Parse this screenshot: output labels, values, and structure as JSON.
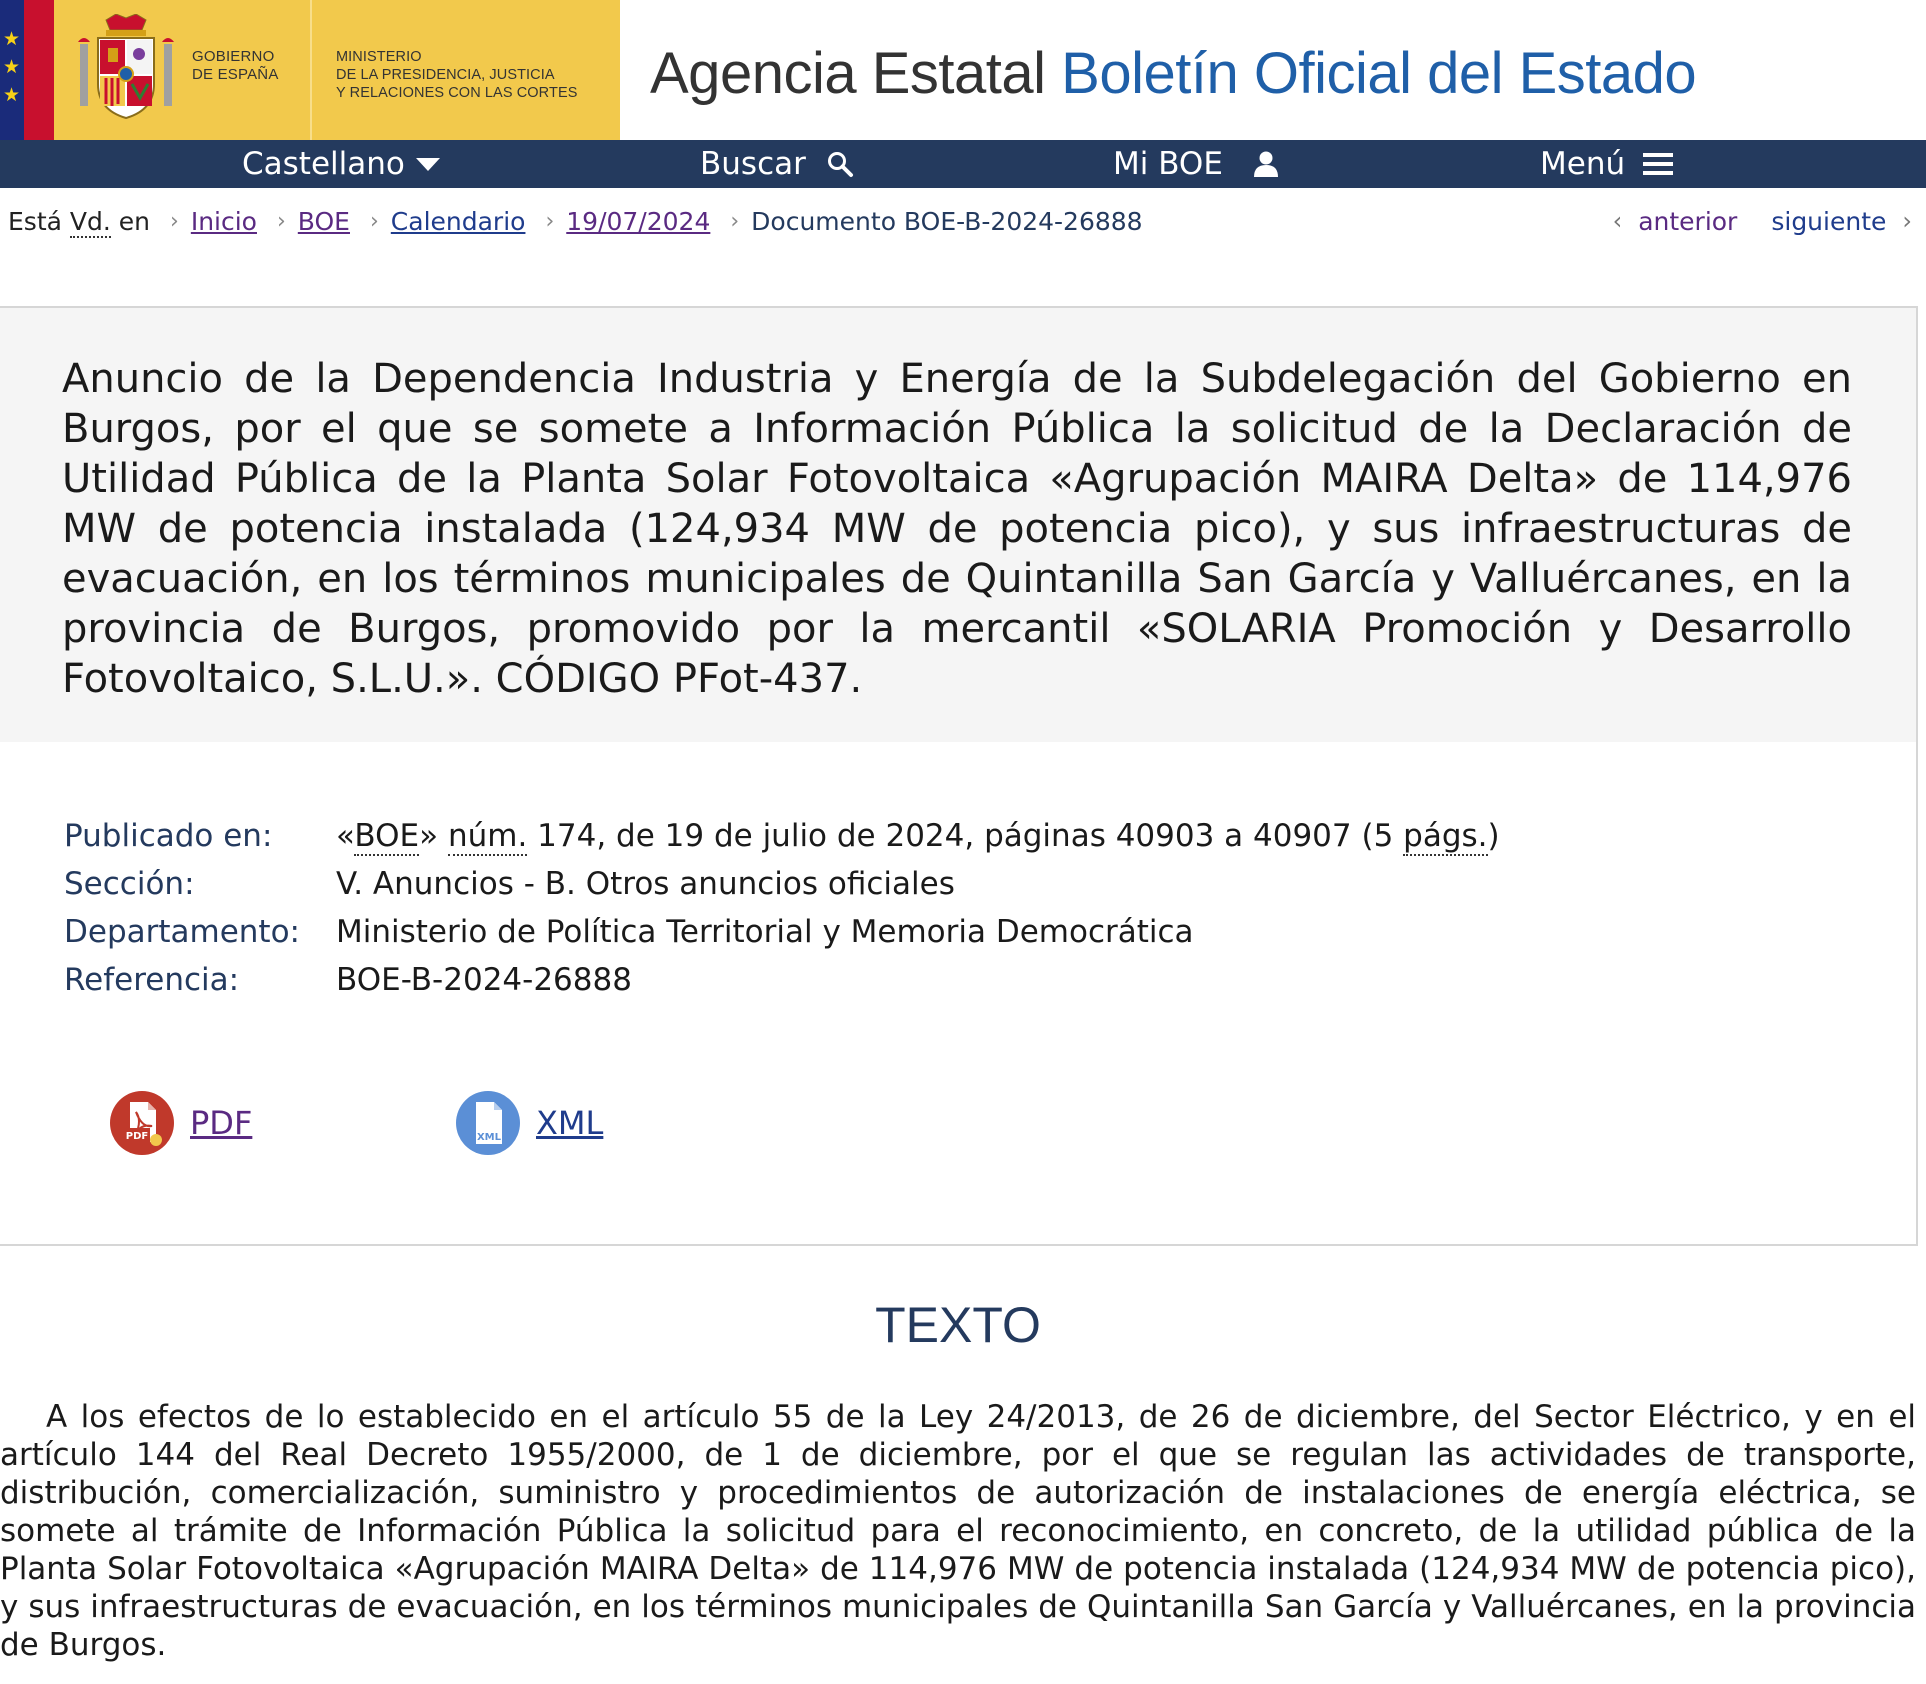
{
  "header": {
    "gov_lines": [
      "GOBIERNO",
      "DE ESPAÑA"
    ],
    "ministry_lines": [
      "MINISTERIO",
      "DE LA PRESIDENCIA, JUSTICIA",
      "Y RELACIONES CON LAS CORTES"
    ],
    "agency_prefix": "Agencia Estatal",
    "agency_name": "Boletín Oficial del Estado"
  },
  "nav": {
    "language": "Castellano",
    "search": "Buscar",
    "account": "Mi BOE",
    "menu": "Menú"
  },
  "breadcrumb": {
    "label_prefix": "Está",
    "label_abbr": "Vd.",
    "label_suffix": "en",
    "items": [
      "Inicio",
      "BOE",
      "Calendario",
      "19/07/2024"
    ],
    "current": "Documento BOE-B-2024-26888",
    "prev": "anterior",
    "next": "siguiente"
  },
  "document": {
    "title": "Anuncio de la Dependencia Industria y Energía de la Subdelegación del Gobierno en Burgos, por el que se somete a Información Pública la solicitud de la Declaración de Utilidad Pública de la Planta Solar Fotovoltaica «Agrupación MAIRA Delta» de 114,976 MW de potencia instalada (124,934 MW de potencia pico), y sus infraestructuras de evacuación, en los términos municipales de Quintanilla San García y Valluércanes, en la provincia de Burgos, promovido por la mercantil «SOLARIA Promoción y Desarrollo Fotovoltaico, S.L.U.». CÓDIGO PFot-437."
  },
  "meta": {
    "published_label": "Publicado en:",
    "published_q1": "«",
    "published_boe": "BOE",
    "published_q2": "» ",
    "published_num_abbr": "núm.",
    "published_rest": " 174, de 19 de julio de 2024, páginas 40903 a 40907 (5 ",
    "published_pags": "págs.",
    "published_close": ")",
    "section_label": "Sección:",
    "section_value": "V. Anuncios - B. Otros anuncios oficiales",
    "department_label": "Departamento:",
    "department_value": "Ministerio de Política Territorial y Memoria Democrática",
    "reference_label": "Referencia:",
    "reference_value": "BOE-B-2024-26888"
  },
  "downloads": {
    "pdf_label": "PDF",
    "pdf_icon_text": "PDF",
    "xml_label": "XML",
    "xml_icon_text": "XML"
  },
  "texto": {
    "heading": "TEXTO",
    "paragraph": "A los efectos de lo establecido en el artículo 55 de la Ley 24/2013, de 26 de diciembre, del Sector Eléctrico, y en el artículo 144 del Real Decreto 1955/2000, de 1 de diciembre, por el que se regulan las actividades de transporte, distribución, comercialización, suministro y procedimientos de autorización de instalaciones de energía eléctrica, se somete al trámite de Información Pública la solicitud para el reconocimiento, en concreto, de la utilidad pública de la Planta Solar Fotovoltaica «Agrupación MAIRA Delta» de 114,976 MW de potencia instalada (124,934 MW de potencia pico), y sus infraestructuras de evacuación, en los términos municipales de Quintanilla San García y Valluércanes, en la provincia de Burgos."
  },
  "colors": {
    "nav_bg": "#243a5e",
    "header_yellow": "#f2c94c",
    "accent_blue": "#1f5fa8",
    "visited_link": "#5a2a82",
    "pdf_red": "#c0392b",
    "xml_blue": "#5b8fd6"
  },
  "icons": {
    "language": "caret-down-icon",
    "search": "search-icon",
    "account": "user-icon",
    "menu": "hamburger-icon",
    "crumb_separator": "chevron-right-icon",
    "prev": "chevron-left-icon",
    "next": "chevron-right-icon",
    "pdf": "pdf-file-icon",
    "xml": "xml-file-icon"
  }
}
